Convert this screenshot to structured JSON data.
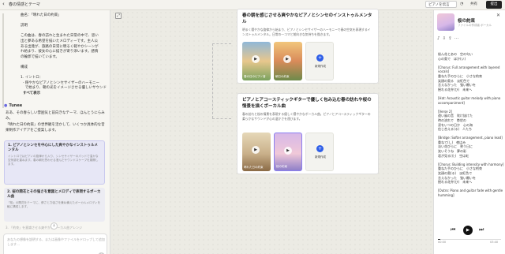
{
  "topbar": {
    "back_icon": "chevron-left-icon",
    "title": "春の情感とテーマ",
    "chevron": "⌄",
    "tab_label": "ピアノを伝言",
    "share_label": "共有",
    "dark_label": "提出"
  },
  "chat": {
    "prev_lines": [
      "曲名：「晴れた日の約束」",
      "",
      "説明",
      "",
      "この曲は、春の訪れと生まれた日常の中で、思い",
      "出と夢ある希望を描いたメロディーです。主人公",
      "ある出発が、旅路の日常に明るく軽やかシーンが",
      "れ始まり、彼女の心に描きが寄り添います。感情",
      "の輪郭で描いています。",
      "",
      "構成",
      "",
      "1. イントロ：",
      "  - 穏やかなピアノとシンセサイザーのハーモニー",
      "    で始まり、朝の光をイメージさせる優しいサウンド",
      "  すべて表示"
    ],
    "tunee_label": "Tunee",
    "intro_para_1": "ああ、その春らしい雰囲気と前向きなテーマ、ほんとうにらみみ。",
    "intro_para_2": "「晴れた日の約束」の世界観を活かして、いくつか具体的な音楽制作アイデアをご提案します。",
    "cards": [
      {
        "title": "1. ピアノとシンセを中心にした爽やかなインストゥルメンタル",
        "desc": "イントロではピアノの旋律から入り、シンセサイザーのパッドで温かな空気感を重ねます。春の朝を思わせる澄んだサウンドスケープを展開します。"
      },
      {
        "title": "2. 桜の開花とその強さを意図とメロディで表現するポーカル曲",
        "desc": "「桜」の開花をテーマに、儚さと力強さを兼ね備えたボーカルメロディを軸に構成します。"
      }
    ],
    "card3_text": "3. 「約束」を意識させる爽やかなポーカル曲アレンジ",
    "input_placeholder": "あなたの想像を説明する、または画像やファイルをドロップして追加します…",
    "input_tools": [
      "plus-icon",
      "attach-icon",
      "settings-icon"
    ]
  },
  "canvas": {
    "nodes": [
      {
        "title": "春の朝を感じさせる爽やかなピアノとシンセのインストゥルメンタル",
        "desc": "明るく穏やかな旋律から始まり、ピアノとシンセサイザーのハーモニーで春の空気を表現するインストゥルメンタル。日常の一コマと前向きな気持ちを描きます。",
        "tracks": [
          {
            "caption": "春の日のピアノ音",
            "colors": [
              "#8fb7d8",
              "#e8c78d",
              "#7aa25e"
            ]
          },
          {
            "caption": "朝日の約束",
            "colors": [
              "#f2c67c",
              "#d98b5a",
              "#6d8a4a"
            ]
          }
        ],
        "add_label": "新規作成"
      },
      {
        "title": "ピアノとアコースティックギターで優しく包み込む春の訪れや桜の情景を描くボーカル曲",
        "desc": "春の訪れと桜の情景を表現する優しく穏やかなボーカル曲。ピアノとアコースティックギターの柔らかなサウンドが心の温かさを運びます。",
        "tracks": [
          {
            "caption": "晴れた日の約束",
            "colors": [
              "#c9b08a",
              "#8a6a45",
              "#e6d8b8"
            ]
          },
          {
            "caption": "桜の約束",
            "colors": [
              "#d7b8e8",
              "#f0c8d8",
              "#8f7fc8"
            ]
          }
        ],
        "add_label": "新規作成"
      }
    ]
  },
  "player": {
    "close_icon": "close-icon",
    "title": "桜の約束",
    "subtitle": "ファイルの作成者 ボーカル",
    "icons": [
      "music-note-icon",
      "download-icon",
      "share-icon",
      "more-icon"
    ],
    "lyrics": "桜ん花とあの　空の匂い\n心の奥で　ほか(い)\n\n[Chorus: Full arrangement with layered vocals]\n重ねた手のひらに　小さな約束\n笑顔の奥る　淡紅色で\n言えなかった　強い願いを\n揺れる花弁(ひ)　未来へ\n\n[Hat: Acoustic guitar melody with piano accompaniment]\n\n[Verse 2]\n遠い風の音　吹け抜けた\n時の流れで　帯状の\n涙をいつの日か　心の海\n信じ合える(る)　人たち\n\n[Bridge: Softer arrangement, piano lead]\n重ねて(し)　夜はみ\n淡い花びらに　誓う日に\n笑いそうね　夢の彩\n君が見る(た)　空は虹\n\n[Chorus: Building intensity with harmony]\n重ねた手のひらに　小さな約束\n笑顔の奥(る)　淡紅色で\n言えなかった　強い願いを\n揺れる花弁(ひ)　未来へ\n\n[Outro: Piano and guitar fade with gentle humming]",
    "time_current": "00:00",
    "time_total": "03:40",
    "progress": 0.04,
    "controls": [
      "prev-icon",
      "play-icon",
      "next-icon"
    ]
  }
}
